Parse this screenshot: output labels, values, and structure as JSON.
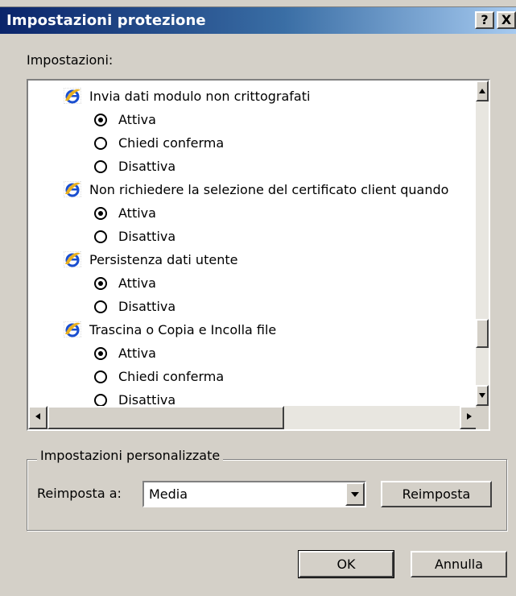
{
  "window": {
    "title": "Impostazioni protezione",
    "help_button": "?",
    "close_button": "X"
  },
  "settings_label": "Impostazioni:",
  "settings": [
    {
      "label": "Invia dati modulo non crittografati",
      "options": [
        {
          "label": "Attiva",
          "checked": true
        },
        {
          "label": "Chiedi conferma",
          "checked": false
        },
        {
          "label": "Disattiva",
          "checked": false
        }
      ]
    },
    {
      "label": "Non richiedere la selezione del certificato client quando",
      "options": [
        {
          "label": "Attiva",
          "checked": true
        },
        {
          "label": "Disattiva",
          "checked": false
        }
      ]
    },
    {
      "label": "Persistenza dati utente",
      "options": [
        {
          "label": "Attiva",
          "checked": true
        },
        {
          "label": "Disattiva",
          "checked": false
        }
      ]
    },
    {
      "label": "Trascina o Copia e Incolla file",
      "options": [
        {
          "label": "Attiva",
          "checked": true
        },
        {
          "label": "Chiedi conferma",
          "checked": false
        },
        {
          "label": "Disattiva",
          "checked": false
        }
      ]
    }
  ],
  "custom": {
    "group_label": "Impostazioni personalizzate",
    "reset_label": "Reimposta a:",
    "reset_value": "Media",
    "reset_button": "Reimposta"
  },
  "buttons": {
    "ok": "OK",
    "cancel": "Annulla"
  },
  "icons": {
    "setting_icon": "internet-explorer-icon",
    "scroll_up": "arrow-up-icon",
    "scroll_down": "arrow-down-icon",
    "scroll_left": "arrow-left-icon",
    "scroll_right": "arrow-right-icon",
    "dropdown": "chevron-down-icon"
  },
  "colors": {
    "title_start": "#0a246a",
    "title_end": "#a6caf0",
    "face": "#d4d0c8",
    "ie_blue": "#1a4fd0"
  }
}
